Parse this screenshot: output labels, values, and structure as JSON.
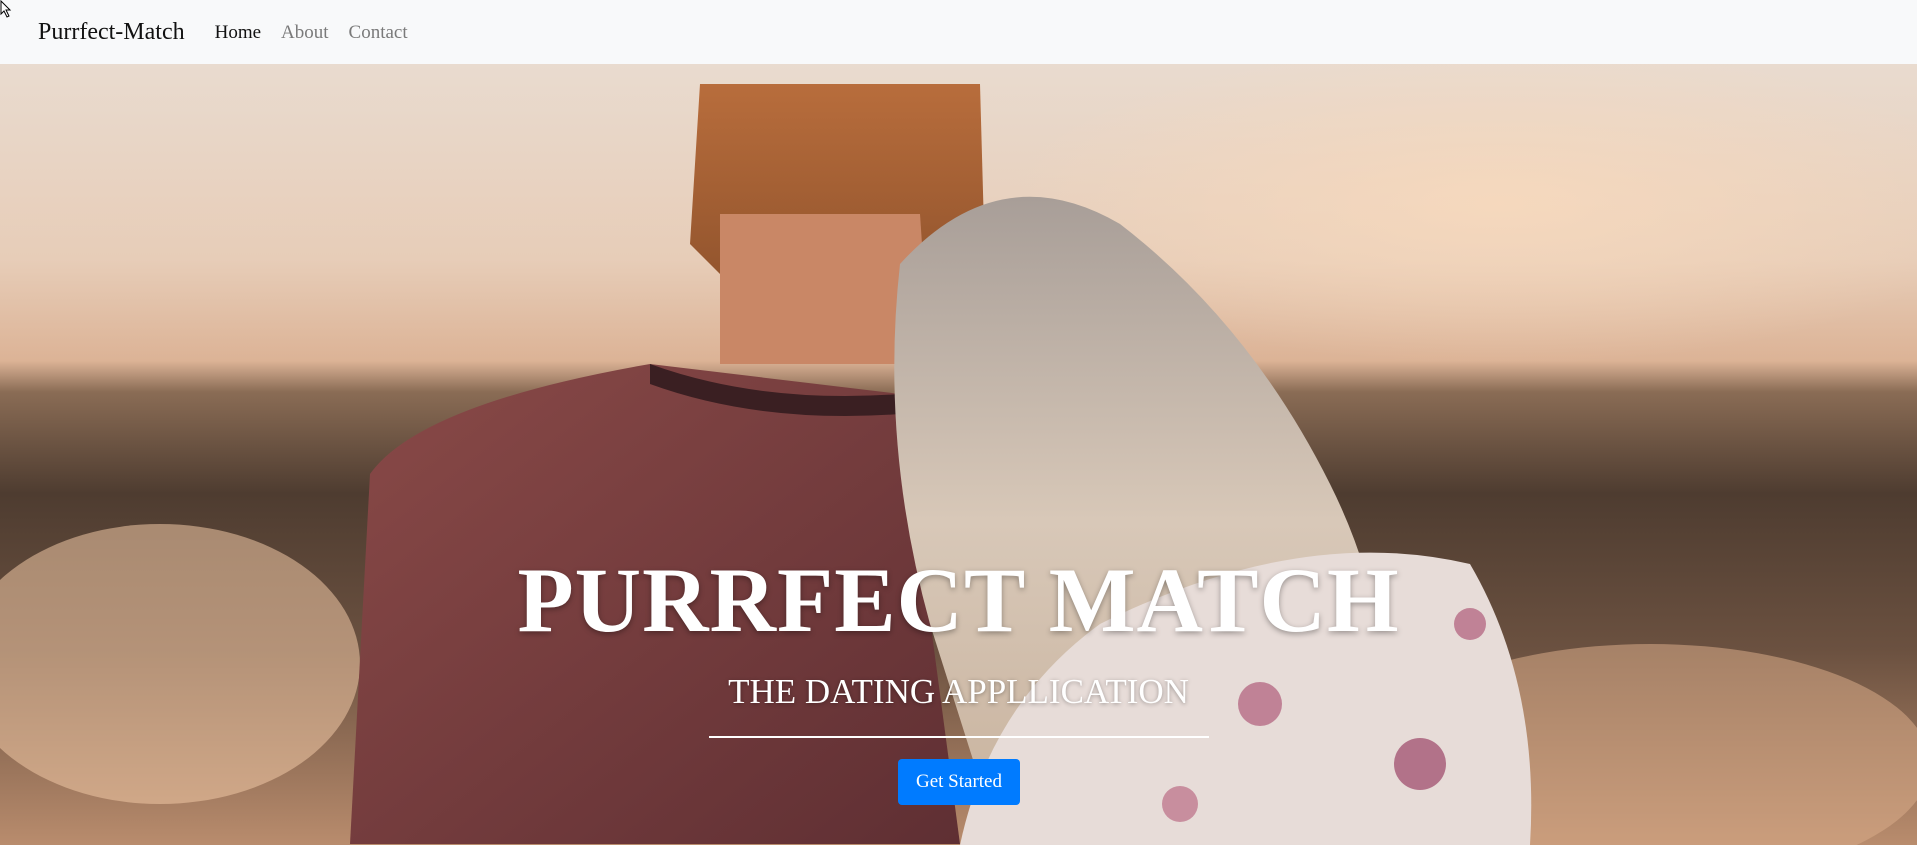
{
  "navbar": {
    "brand": "Purrfect-Match",
    "links": [
      {
        "label": "Home",
        "active": true
      },
      {
        "label": "About",
        "active": false
      },
      {
        "label": "Contact",
        "active": false
      }
    ]
  },
  "hero": {
    "background_image": "couple-at-sunset-photo",
    "title": "PURRFECT MATCH",
    "subtitle": "THE DATING APPLLICATION",
    "cta_label": "Get Started"
  },
  "colors": {
    "navbar_bg": "#f8f9fa",
    "cta_bg": "#007bff",
    "hero_text": "#ffffff"
  }
}
